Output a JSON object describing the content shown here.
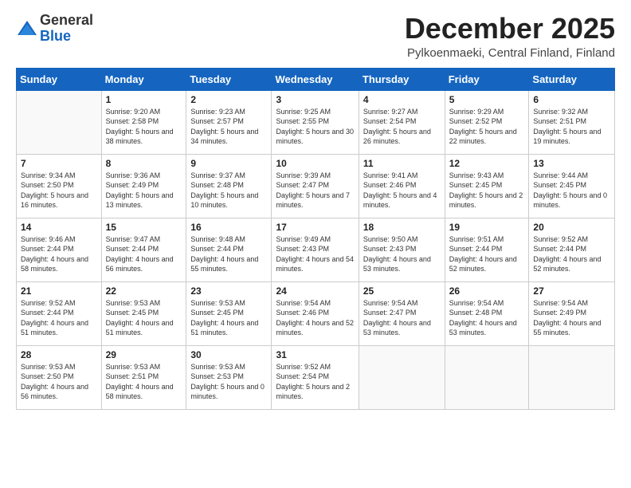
{
  "logo": {
    "general": "General",
    "blue": "Blue"
  },
  "header": {
    "month": "December 2025",
    "location": "Pylkoenmaeki, Central Finland, Finland"
  },
  "weekdays": [
    "Sunday",
    "Monday",
    "Tuesday",
    "Wednesday",
    "Thursday",
    "Friday",
    "Saturday"
  ],
  "weeks": [
    [
      {
        "day": null
      },
      {
        "day": "1",
        "sunrise": "9:20 AM",
        "sunset": "2:58 PM",
        "daylight": "5 hours and 38 minutes."
      },
      {
        "day": "2",
        "sunrise": "9:23 AM",
        "sunset": "2:57 PM",
        "daylight": "5 hours and 34 minutes."
      },
      {
        "day": "3",
        "sunrise": "9:25 AM",
        "sunset": "2:55 PM",
        "daylight": "5 hours and 30 minutes."
      },
      {
        "day": "4",
        "sunrise": "9:27 AM",
        "sunset": "2:54 PM",
        "daylight": "5 hours and 26 minutes."
      },
      {
        "day": "5",
        "sunrise": "9:29 AM",
        "sunset": "2:52 PM",
        "daylight": "5 hours and 22 minutes."
      },
      {
        "day": "6",
        "sunrise": "9:32 AM",
        "sunset": "2:51 PM",
        "daylight": "5 hours and 19 minutes."
      }
    ],
    [
      {
        "day": "7",
        "sunrise": "9:34 AM",
        "sunset": "2:50 PM",
        "daylight": "5 hours and 16 minutes."
      },
      {
        "day": "8",
        "sunrise": "9:36 AM",
        "sunset": "2:49 PM",
        "daylight": "5 hours and 13 minutes."
      },
      {
        "day": "9",
        "sunrise": "9:37 AM",
        "sunset": "2:48 PM",
        "daylight": "5 hours and 10 minutes."
      },
      {
        "day": "10",
        "sunrise": "9:39 AM",
        "sunset": "2:47 PM",
        "daylight": "5 hours and 7 minutes."
      },
      {
        "day": "11",
        "sunrise": "9:41 AM",
        "sunset": "2:46 PM",
        "daylight": "5 hours and 4 minutes."
      },
      {
        "day": "12",
        "sunrise": "9:43 AM",
        "sunset": "2:45 PM",
        "daylight": "5 hours and 2 minutes."
      },
      {
        "day": "13",
        "sunrise": "9:44 AM",
        "sunset": "2:45 PM",
        "daylight": "5 hours and 0 minutes."
      }
    ],
    [
      {
        "day": "14",
        "sunrise": "9:46 AM",
        "sunset": "2:44 PM",
        "daylight": "4 hours and 58 minutes."
      },
      {
        "day": "15",
        "sunrise": "9:47 AM",
        "sunset": "2:44 PM",
        "daylight": "4 hours and 56 minutes."
      },
      {
        "day": "16",
        "sunrise": "9:48 AM",
        "sunset": "2:44 PM",
        "daylight": "4 hours and 55 minutes."
      },
      {
        "day": "17",
        "sunrise": "9:49 AM",
        "sunset": "2:43 PM",
        "daylight": "4 hours and 54 minutes."
      },
      {
        "day": "18",
        "sunrise": "9:50 AM",
        "sunset": "2:43 PM",
        "daylight": "4 hours and 53 minutes."
      },
      {
        "day": "19",
        "sunrise": "9:51 AM",
        "sunset": "2:44 PM",
        "daylight": "4 hours and 52 minutes."
      },
      {
        "day": "20",
        "sunrise": "9:52 AM",
        "sunset": "2:44 PM",
        "daylight": "4 hours and 52 minutes."
      }
    ],
    [
      {
        "day": "21",
        "sunrise": "9:52 AM",
        "sunset": "2:44 PM",
        "daylight": "4 hours and 51 minutes."
      },
      {
        "day": "22",
        "sunrise": "9:53 AM",
        "sunset": "2:45 PM",
        "daylight": "4 hours and 51 minutes."
      },
      {
        "day": "23",
        "sunrise": "9:53 AM",
        "sunset": "2:45 PM",
        "daylight": "4 hours and 51 minutes."
      },
      {
        "day": "24",
        "sunrise": "9:54 AM",
        "sunset": "2:46 PM",
        "daylight": "4 hours and 52 minutes."
      },
      {
        "day": "25",
        "sunrise": "9:54 AM",
        "sunset": "2:47 PM",
        "daylight": "4 hours and 53 minutes."
      },
      {
        "day": "26",
        "sunrise": "9:54 AM",
        "sunset": "2:48 PM",
        "daylight": "4 hours and 53 minutes."
      },
      {
        "day": "27",
        "sunrise": "9:54 AM",
        "sunset": "2:49 PM",
        "daylight": "4 hours and 55 minutes."
      }
    ],
    [
      {
        "day": "28",
        "sunrise": "9:53 AM",
        "sunset": "2:50 PM",
        "daylight": "4 hours and 56 minutes."
      },
      {
        "day": "29",
        "sunrise": "9:53 AM",
        "sunset": "2:51 PM",
        "daylight": "4 hours and 58 minutes."
      },
      {
        "day": "30",
        "sunrise": "9:53 AM",
        "sunset": "2:53 PM",
        "daylight": "5 hours and 0 minutes."
      },
      {
        "day": "31",
        "sunrise": "9:52 AM",
        "sunset": "2:54 PM",
        "daylight": "5 hours and 2 minutes."
      },
      {
        "day": null
      },
      {
        "day": null
      },
      {
        "day": null
      }
    ]
  ]
}
